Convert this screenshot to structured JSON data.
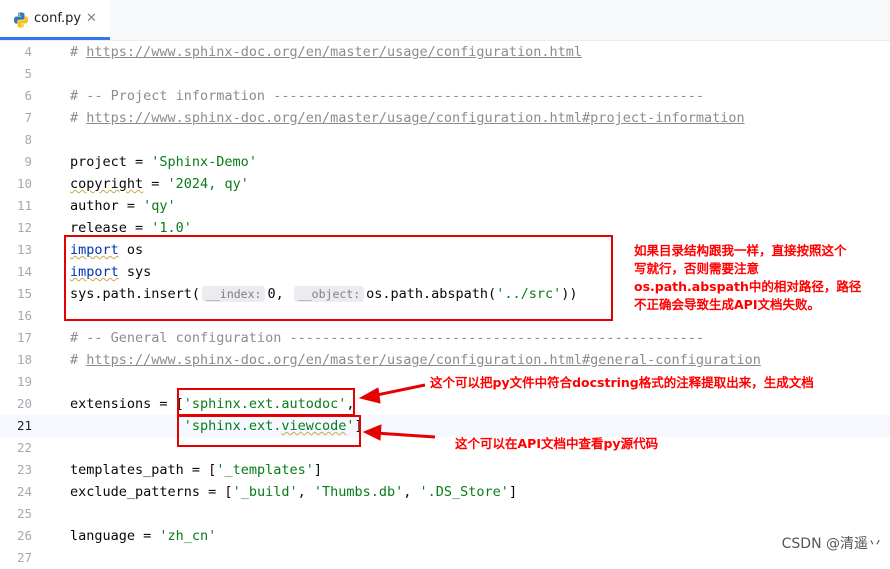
{
  "tab": {
    "filename": "conf.py",
    "close_glyph": "✕"
  },
  "lines": [
    {
      "n": "4"
    },
    {
      "n": "5"
    },
    {
      "n": "6"
    },
    {
      "n": "7"
    },
    {
      "n": "8"
    },
    {
      "n": "9"
    },
    {
      "n": "10"
    },
    {
      "n": "11"
    },
    {
      "n": "12"
    },
    {
      "n": "13"
    },
    {
      "n": "14"
    },
    {
      "n": "15"
    },
    {
      "n": "16"
    },
    {
      "n": "17"
    },
    {
      "n": "18"
    },
    {
      "n": "19"
    },
    {
      "n": "20"
    },
    {
      "n": "21"
    },
    {
      "n": "22"
    },
    {
      "n": "23"
    },
    {
      "n": "24"
    },
    {
      "n": "25"
    },
    {
      "n": "26"
    },
    {
      "n": "27"
    }
  ],
  "code": {
    "l4_hash": "# ",
    "l4_link": "https://www.sphinx-doc.org/en/master/usage/configuration.html",
    "l6": "# -- Project information -----------------------------------------------------",
    "l7_hash": "# ",
    "l7_link": "https://www.sphinx-doc.org/en/master/usage/configuration.html#project-information",
    "l9_a": "project = ",
    "l9_s": "'Sphinx-Demo'",
    "l10_a": "copyright",
    "l10_b": " = ",
    "l10_s": "'2024, qy'",
    "l11_a": "author = ",
    "l11_s": "'qy'",
    "l12_a": "release = ",
    "l12_s": "'1.0'",
    "l13_kw": "import",
    "l13_b": " os",
    "l14_kw": "import",
    "l14_b": " sys",
    "l15_a": "sys.path.insert(",
    "l15_hint1": "__index:",
    "l15_b": "0, ",
    "l15_hint2": "__object:",
    "l15_c": "os.path.abspath(",
    "l15_s": "'../src'",
    "l15_d": "))",
    "l17": "# -- General configuration ---------------------------------------------------",
    "l18_hash": "# ",
    "l18_link": "https://www.sphinx-doc.org/en/master/usage/configuration.html#general-configuration",
    "l20_a": "extensions = [",
    "l20_s": "'sphinx.ext.autodoc'",
    "l20_b": ",",
    "l21_pad": "              ",
    "l21_s1": "'sphinx.ext.",
    "l21_s2": "viewcode",
    "l21_s3": "'",
    "l21_b": "]",
    "l23_a": "templates_path = [",
    "l23_s": "'_templates'",
    "l23_b": "]",
    "l24_a": "exclude_patterns = [",
    "l24_s1": "'_build'",
    "l24_b": ", ",
    "l24_s2": "'Thumbs.db'",
    "l24_c": ", ",
    "l24_s3": "'.DS_Store'",
    "l24_d": "]",
    "l26_a": "language = ",
    "l26_s": "'zh_cn'"
  },
  "annotations": {
    "note1": [
      "如果目录结构跟我一样，直接按照这个",
      "写就行，否则需要注意",
      "os.path.abspath中的相对路径，路径",
      "不正确会导致生成API文档失败。"
    ],
    "note2": "这个可以把py文件中符合docstring格式的注释提取出来，生成文档",
    "note3": "这个可以在API文档中查看py源代码"
  },
  "watermark": "CSDN @清遥丷",
  "colors": {
    "annotation_red": "#e60000",
    "tab_accent": "#3574f0",
    "string_green": "#067d17",
    "keyword_blue": "#0033b3",
    "comment_gray": "#8c8c8c"
  }
}
